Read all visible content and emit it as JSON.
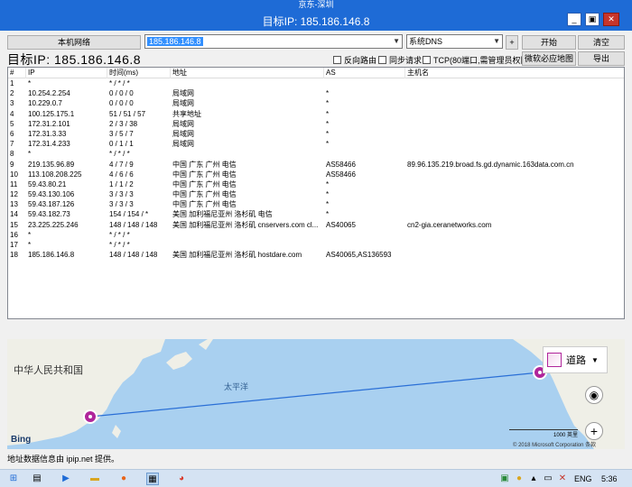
{
  "os_title": "京东-深圳",
  "window": {
    "title": "目标IP: 185.186.146.8",
    "minimize": "_",
    "restore": "▣",
    "close": "✕"
  },
  "toolbar": {
    "local_network_label": "本机网络",
    "ip_input_value": "185.186.146.8",
    "dns_select_value": "系统DNS",
    "add_label": "+",
    "start_label": "开始",
    "clear_label": "清空",
    "reverse_route_label": "反向路由",
    "sync_request_label": "同步请求",
    "tcp_label": "TCP(80端口,需管理员权限)",
    "map_label": "微软必应地图",
    "export_label": "导出"
  },
  "target_ip_label": "目标IP:  185.186.146.8",
  "table": {
    "headers": [
      "#",
      "IP",
      "时间(ms)",
      "地址",
      "AS",
      "主机名"
    ],
    "rows": [
      [
        "1",
        "*",
        "* / * / *",
        "",
        "",
        ""
      ],
      [
        "2",
        "10.254.2.254",
        "0 / 0 / 0",
        "局域网",
        "*",
        ""
      ],
      [
        "3",
        "10.229.0.7",
        "0 / 0 / 0",
        "局域网",
        "*",
        ""
      ],
      [
        "4",
        "100.125.175.1",
        "51 / 51 / 57",
        "共享地址",
        "*",
        ""
      ],
      [
        "5",
        "172.31.2.101",
        "2 / 3 / 38",
        "局域网",
        "*",
        ""
      ],
      [
        "6",
        "172.31.3.33",
        "3 / 5 / 7",
        "局域网",
        "*",
        ""
      ],
      [
        "7",
        "172.31.4.233",
        "0 / 1 / 1",
        "局域网",
        "*",
        ""
      ],
      [
        "8",
        "*",
        "* / * / *",
        "",
        "",
        ""
      ],
      [
        "9",
        "219.135.96.89",
        "4 / 7 / 9",
        "中国 广东 广州 电信",
        "AS58466",
        "89.96.135.219.broad.fs.gd.dynamic.163data.com.cn"
      ],
      [
        "10",
        "113.108.208.225",
        "4 / 6 / 6",
        "中国 广东 广州 电信",
        "AS58466",
        ""
      ],
      [
        "11",
        "59.43.80.21",
        "1 / 1 / 2",
        "中国 广东 广州 电信",
        "*",
        ""
      ],
      [
        "12",
        "59.43.130.106",
        "3 / 3 / 3",
        "中国 广东 广州 电信",
        "*",
        ""
      ],
      [
        "13",
        "59.43.187.126",
        "3 / 3 / 3",
        "中国 广东 广州 电信",
        "*",
        ""
      ],
      [
        "14",
        "59.43.182.73",
        "154 / 154 / *",
        "美国 加利福尼亚州 洛杉矶 电信",
        "*",
        ""
      ],
      [
        "15",
        "23.225.225.246",
        "148 / 148 / 148",
        "美国 加利福尼亚州 洛杉矶 cnservers.com cl...",
        "AS40065",
        "cn2-gia.ceranetworks.com"
      ],
      [
        "16",
        "*",
        "* / * / *",
        "",
        "",
        ""
      ],
      [
        "17",
        "*",
        "* / * / *",
        "",
        "",
        ""
      ],
      [
        "18",
        "185.186.146.8",
        "148 / 148 / 148",
        "美国 加利福尼亚州 洛杉矶 hostdare.com",
        "AS40065,AS136593",
        ""
      ]
    ]
  },
  "map": {
    "country_label": "中华人民共和国",
    "ocean_label": "太平洋",
    "road_label": "道路",
    "bing_label": "Bing",
    "scale_label": "1000 英里",
    "scale_label_2": "1000 公里",
    "copyright": "© 2018 Microsoft Corporation",
    "terms": "条款"
  },
  "status_text": "地址数据信息由 ipip.net 提供。",
  "taskbar": {
    "ime": "ENG",
    "time": "5:36"
  },
  "colors": {
    "titlebar": "#1e6bd6",
    "pin": "#b0269b",
    "route": "#2a6fd6",
    "sea": "#a9d0f0",
    "land": "#efefe7"
  }
}
